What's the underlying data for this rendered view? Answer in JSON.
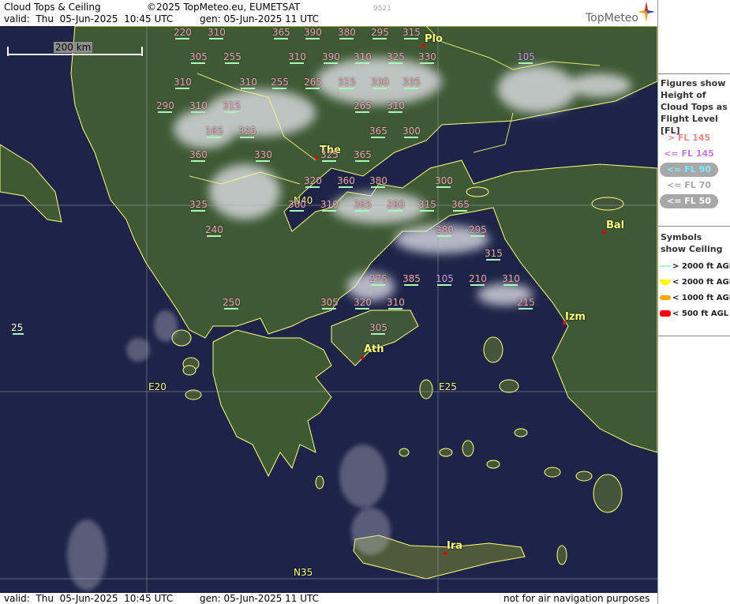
{
  "header": {
    "title": "Cloud Tops & Ceiling",
    "valid": "valid:  Thu  05-Jun-2025  10:45 UTC",
    "copyright": "©2025 TopMeteo.eu, EUMETSAT",
    "gen": "gen: 05-Jun-2025 11 UTC",
    "code": "9521",
    "logo": "TopMeteo"
  },
  "footer": {
    "valid": "valid:  Thu  05-Jun-2025  10:45 UTC",
    "gen": "gen: 05-Jun-2025 11 UTC",
    "disclaimer": "not for air navigation purposes"
  },
  "scale": {
    "label": "200 km"
  },
  "legend": {
    "figures_title": "Figures show Height of Cloud Tops as Flight Level  [FL]",
    "levels": [
      {
        "label": "> FL 145",
        "color": "#e68a8a"
      },
      {
        "label": "<= FL 145",
        "color": "#c37be6"
      },
      {
        "label": "<= FL 90",
        "color": "#7fe9ff"
      },
      {
        "label": "<= FL 70",
        "color": "#a8a8a8"
      },
      {
        "label": "<= FL 50",
        "color": "#ffffff"
      }
    ],
    "symbols_title": "Symbols show Ceiling",
    "symbols": [
      {
        "label": "> 2000 ft AGL",
        "color": "#a8ffb8"
      },
      {
        "label": "< 2000 ft AGL",
        "color": "#ffff00"
      },
      {
        "label": "< 1000 ft AGL",
        "color": "#ffa500"
      },
      {
        "label": "< 500 ft AGL",
        "color": "#ff0000"
      }
    ]
  },
  "cities": [
    "Plo",
    "The",
    "Bal",
    "Izm",
    "Ath",
    "Ira"
  ],
  "grid_labels": [
    "N40",
    "E20",
    "E25",
    "N35"
  ],
  "flight_levels": [
    "220",
    "310",
    "365",
    "390",
    "380",
    "295",
    "315",
    "305",
    "255",
    "310",
    "390",
    "310",
    "325",
    "330",
    "105",
    "310",
    "310",
    "255",
    "265",
    "315",
    "330",
    "335",
    "290",
    "310",
    "315",
    "265",
    "310",
    "165",
    "325",
    "365",
    "300",
    "360",
    "330",
    "325",
    "365",
    "320",
    "360",
    "380",
    "300",
    "325",
    "360",
    "310",
    "365",
    "280",
    "315",
    "365",
    "280",
    "295",
    "240",
    "315",
    "250",
    "275",
    "385",
    "105",
    "210",
    "310",
    "305",
    "320",
    "310",
    "305",
    "215",
    "25"
  ]
}
